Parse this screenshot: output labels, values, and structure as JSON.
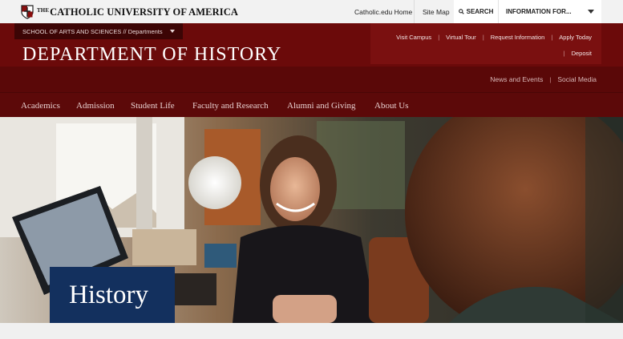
{
  "topbar": {
    "brand_the": "THE",
    "brand_name": "CATHOLIC UNIVERSITY OF AMERICA",
    "links": [
      "Catholic.edu Home",
      "Site Map"
    ],
    "search_label": "SEARCH",
    "info_label": "INFORMATION FOR..."
  },
  "header": {
    "breadcrumb": "SCHOOL OF ARTS AND SCIENCES // Departments",
    "title": "DEPARTMENT OF HISTORY",
    "quick_links": [
      "Visit Campus",
      "Virtual Tour",
      "Request Information",
      "Apply Today"
    ],
    "deposit": "Deposit",
    "social_links": [
      "News and Events",
      "Social Media"
    ],
    "separator": "|"
  },
  "nav": {
    "items": [
      "Academics",
      "Admission",
      "Student Life",
      "Faculty and Research",
      "Alumni and Giving",
      "About Us"
    ]
  },
  "hero": {
    "label": "History"
  },
  "colors": {
    "header_red": "#6b0a0a",
    "nav_red": "#5c0909",
    "label_blue": "#13305e"
  }
}
